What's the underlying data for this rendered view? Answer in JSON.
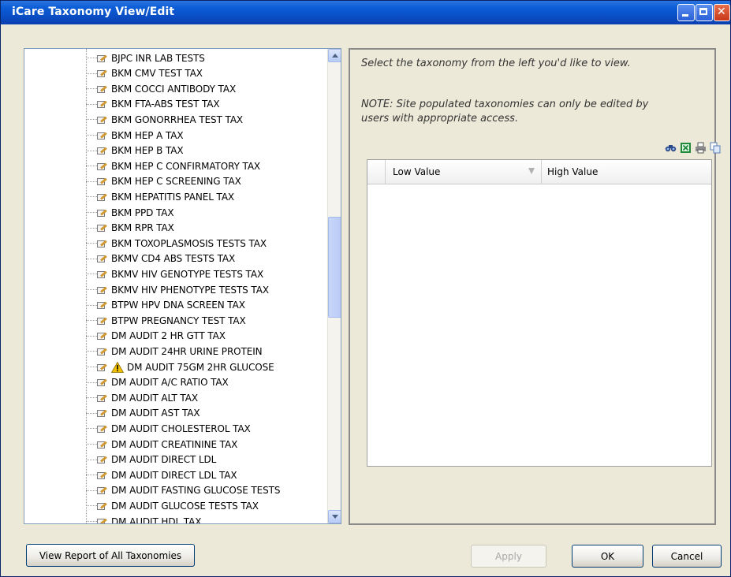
{
  "window": {
    "title": "iCare Taxonomy View/Edit"
  },
  "tree": {
    "items": [
      {
        "label": "BJPC INR LAB TESTS",
        "warning": false
      },
      {
        "label": "BKM CMV TEST TAX",
        "warning": false
      },
      {
        "label": "BKM COCCI ANTIBODY TAX",
        "warning": false
      },
      {
        "label": "BKM FTA-ABS TEST TAX",
        "warning": false
      },
      {
        "label": "BKM GONORRHEA TEST TAX",
        "warning": false
      },
      {
        "label": "BKM HEP A TAX",
        "warning": false
      },
      {
        "label": "BKM HEP B TAX",
        "warning": false
      },
      {
        "label": "BKM HEP C CONFIRMATORY TAX",
        "warning": false
      },
      {
        "label": "BKM HEP C SCREENING TAX",
        "warning": false
      },
      {
        "label": "BKM HEPATITIS PANEL TAX",
        "warning": false
      },
      {
        "label": "BKM PPD TAX",
        "warning": false
      },
      {
        "label": "BKM RPR TAX",
        "warning": false
      },
      {
        "label": "BKM TOXOPLASMOSIS TESTS TAX",
        "warning": false
      },
      {
        "label": "BKMV CD4 ABS TESTS TAX",
        "warning": false
      },
      {
        "label": "BKMV HIV GENOTYPE TESTS TAX",
        "warning": false
      },
      {
        "label": "BKMV HIV PHENOTYPE TESTS TAX",
        "warning": false
      },
      {
        "label": "BTPW HPV DNA SCREEN TAX",
        "warning": false
      },
      {
        "label": "BTPW PREGNANCY TEST TAX",
        "warning": false
      },
      {
        "label": "DM AUDIT 2 HR GTT TAX",
        "warning": false
      },
      {
        "label": "DM AUDIT 24HR URINE PROTEIN",
        "warning": false
      },
      {
        "label": "DM AUDIT 75GM 2HR GLUCOSE",
        "warning": true
      },
      {
        "label": "DM AUDIT A/C RATIO TAX",
        "warning": false
      },
      {
        "label": "DM AUDIT ALT TAX",
        "warning": false
      },
      {
        "label": "DM AUDIT AST TAX",
        "warning": false
      },
      {
        "label": "DM AUDIT CHOLESTEROL TAX",
        "warning": false
      },
      {
        "label": "DM AUDIT CREATININE TAX",
        "warning": false
      },
      {
        "label": "DM AUDIT DIRECT LDL",
        "warning": false
      },
      {
        "label": "DM AUDIT DIRECT LDL TAX",
        "warning": false
      },
      {
        "label": "DM AUDIT FASTING GLUCOSE TESTS",
        "warning": false
      },
      {
        "label": "DM AUDIT GLUCOSE TESTS TAX",
        "warning": false
      },
      {
        "label": "DM AUDIT HDL TAX",
        "warning": false
      }
    ],
    "item_icon": "edit-pencil-icon",
    "warning_icon": "warning-icon"
  },
  "right": {
    "hint": "Select the taxonomy from the left you'd like to view.",
    "note_line1": "NOTE: Site populated taxonomies can only be edited by",
    "note_line2": "users with appropriate access.",
    "toolbar_icons": [
      "find-icon",
      "excel-export-icon",
      "print-icon",
      "copy-icon"
    ],
    "grid": {
      "columns": [
        "Low Value",
        "High Value"
      ],
      "rows": []
    }
  },
  "buttons": {
    "report": "View Report of All Taxonomies",
    "apply": "Apply",
    "ok": "OK",
    "cancel": "Cancel"
  },
  "colors": {
    "titlebar": "#0A4CC2",
    "background": "#ECE9D8",
    "warning": "#F2C200"
  }
}
